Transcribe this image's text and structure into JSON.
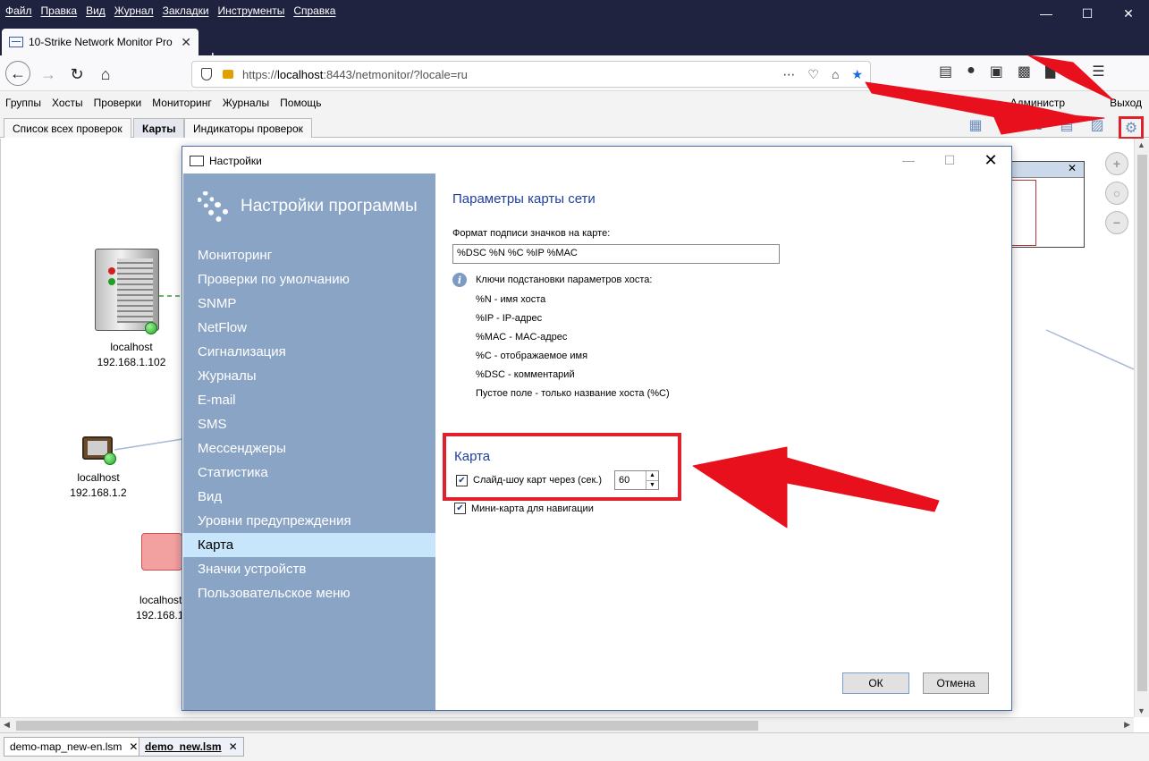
{
  "browser": {
    "menu": [
      "Файл",
      "Правка",
      "Вид",
      "Журнал",
      "Закладки",
      "Инструменты",
      "Справка"
    ],
    "tab_title": "10-Strike Network Monitor Pro",
    "url_prefix": "https://",
    "url_host": "localhost",
    "url_rest": ":8443/netmonitor/?locale=ru"
  },
  "app": {
    "menu": [
      "Группы",
      "Хосты",
      "Проверки",
      "Мониторинг",
      "Журналы",
      "Помощь"
    ],
    "user_label": "Администр",
    "logout_label": "Выход",
    "tabs": [
      "Список всех проверок",
      "Карты",
      "Индикаторы проверок"
    ],
    "active_tab": "Карты",
    "bottom_tabs": [
      "demo-map_new-en.lsm",
      "demo_new.lsm"
    ]
  },
  "map": {
    "hosts": [
      {
        "name": "localhost",
        "ip": "192.168.1.102"
      },
      {
        "name": "localhost",
        "ip": "192.168.1.2"
      },
      {
        "name": "localhost",
        "ip": "192.168.1"
      }
    ],
    "minimap_close": "✕"
  },
  "dialog": {
    "title": "Настройки",
    "sidebar_heading": "Настройки программы",
    "sidebar_items": [
      "Мониторинг",
      "Проверки по умолчанию",
      "SNMP",
      "NetFlow",
      "Сигнализация",
      "Журналы",
      "E-mail",
      "SMS",
      "Мессенджеры",
      "Статистика",
      "Вид",
      "Уровни предупреждения",
      "Карта",
      "Значки устройств",
      "Пользовательское меню"
    ],
    "active_item": "Карта",
    "section_title": "Параметры карты сети",
    "format_label": "Формат подписи значков на карте:",
    "format_value": "%DSC %N %C %IP %MAC",
    "keys_title": "Ключи подстановки параметров хоста:",
    "keys": [
      "%N - имя хоста",
      "%IP - IP-адрес",
      "%MAC - MAC-адрес",
      "%C - отображаемое имя",
      "%DSC - комментарий",
      "Пустое поле - только название хоста (%C)"
    ],
    "map_group_title": "Карта",
    "slideshow_label": "Слайд-шоу карт через (сек.)",
    "slideshow_checked": true,
    "slideshow_value": "60",
    "minimap_label": "Мини-карта для навигации",
    "minimap_checked": true,
    "ok_label": "ОК",
    "cancel_label": "Отмена"
  },
  "colors": {
    "annotation": "#e0202a",
    "sidebar": "#8aa4c6",
    "active_item": "#c8e6fb",
    "titlebar": "#202340"
  }
}
